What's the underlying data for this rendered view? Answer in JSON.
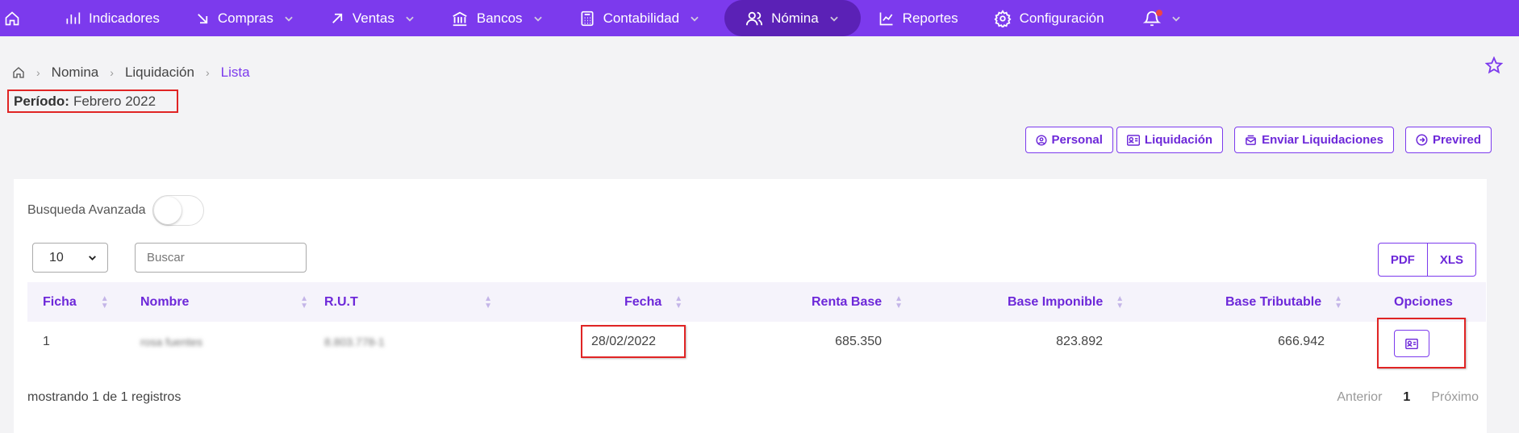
{
  "nav": {
    "items": [
      {
        "label": "Indicadores",
        "icon": "bar-chart-icon"
      },
      {
        "label": "Compras",
        "icon": "arrow-down-right-icon"
      },
      {
        "label": "Ventas",
        "icon": "arrow-up-right-icon"
      },
      {
        "label": "Bancos",
        "icon": "bank-icon"
      },
      {
        "label": "Contabilidad",
        "icon": "calculator-icon"
      },
      {
        "label": "Nómina",
        "icon": "users-icon",
        "active": true
      },
      {
        "label": "Reportes",
        "icon": "line-chart-icon"
      },
      {
        "label": "Configuración",
        "icon": "gear-icon"
      }
    ],
    "accent": "#7c3aed",
    "active_bg": "#5b21b6"
  },
  "breadcrumb": {
    "items": [
      "Nomina",
      "Liquidación",
      "Lista"
    ]
  },
  "periodo": {
    "label": "Período:",
    "value": "Febrero 2022"
  },
  "actions": {
    "personal": "Personal",
    "liquidacion": "Liquidación",
    "enviar": "Enviar Liquidaciones",
    "previred": "Previred"
  },
  "filters": {
    "advanced_label": "Busqueda Avanzada",
    "page_size": "10",
    "search_placeholder": "Buscar"
  },
  "export": {
    "pdf": "PDF",
    "xls": "XLS"
  },
  "table": {
    "columns": {
      "ficha": "Ficha",
      "nombre": "Nombre",
      "rut": "R.U.T",
      "fecha": "Fecha",
      "renta": "Renta Base",
      "imponible": "Base Imponible",
      "tributable": "Base Tributable",
      "opciones": "Opciones"
    },
    "rows": [
      {
        "ficha": "1",
        "nombre": "rosa fuentes",
        "rut": "8.803.778-1",
        "fecha": "28/02/2022",
        "renta": "685.350",
        "imponible": "823.892",
        "tributable": "666.942"
      }
    ]
  },
  "footer": {
    "summary": "mostrando 1 de 1 registros",
    "prev": "Anterior",
    "page": "1",
    "next": "Próximo"
  }
}
